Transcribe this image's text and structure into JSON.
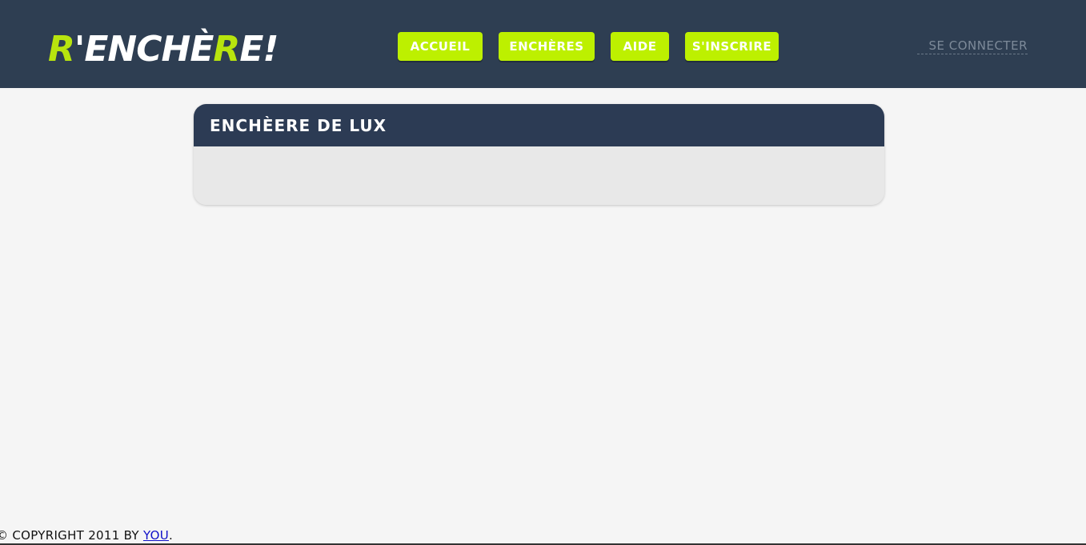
{
  "header": {
    "logo": {
      "part1": "R",
      "part2": "'ENCHÈ",
      "part3": "R",
      "part4": "E!"
    },
    "nav": [
      {
        "label": "ACCUEIL"
      },
      {
        "label": "ENCHÈRES"
      },
      {
        "label": "AIDE"
      },
      {
        "label": "S'INSCRIRE"
      }
    ],
    "login_label": "SE CONNECTER"
  },
  "main": {
    "panel_title": "ENCHÈERE DE LUX"
  },
  "footer": {
    "copyright_text": "© COPYRIGHT 2011 BY ",
    "link_label": "YOU",
    "trailing": "."
  },
  "colors": {
    "header_bg": "#2e3e52",
    "accent": "#bdf000",
    "panel_header_bg": "#2c3b54",
    "page_bg": "#f5f5f5"
  }
}
